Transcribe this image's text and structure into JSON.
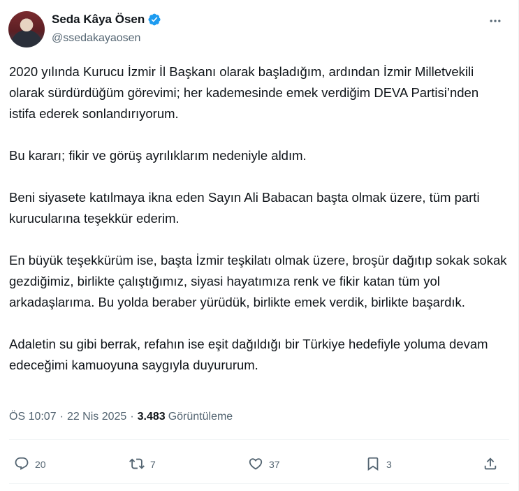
{
  "author": {
    "name": "Seda Kâya Ösen",
    "handle": "@ssedakayaosen"
  },
  "tweet": {
    "text": "2020 yılında Kurucu İzmir İl Başkanı olarak başladığım, ardından İzmir Milletvekili olarak sürdürdüğüm görevimi; her kademesinde emek verdiğim DEVA Partisi’nden istifa ederek sonlandırıyorum.\n\nBu kararı; fikir ve görüş ayrılıklarım nedeniyle aldım.\n\nBeni siyasete katılmaya ikna eden Sayın Ali Babacan başta olmak üzere, tüm parti kurucularına teşekkür ederim.\n\nEn büyük teşekkürüm ise, başta İzmir teşkilatı olmak üzere, broşür dağıtıp sokak sokak gezdiğimiz, birlikte çalıştığımız, siyasi hayatımıza renk ve fikir katan tüm yol arkadaşlarıma. Bu yolda beraber yürüdük, birlikte emek verdik, birlikte başardık.\n\nAdaletin su gibi berrak, refahın ise eşit dağıldığı bir Türkiye hedefiyle yoluma devam edeceğimi kamuoyuna saygıyla duyururum.",
    "time": "ÖS 10:07",
    "date": "22 Nis 2025",
    "views_count": "3.483",
    "views_label": "Görüntüleme"
  },
  "actions": {
    "replies": "20",
    "retweets": "7",
    "likes": "37",
    "bookmarks": "3"
  },
  "icons": {
    "verified": "verified-badge-icon",
    "more": "more-dots-icon",
    "reply": "reply-icon",
    "retweet": "retweet-icon",
    "like": "heart-icon",
    "bookmark": "bookmark-icon",
    "share": "share-icon"
  },
  "colors": {
    "verified": "#1d9bf0",
    "muted": "#536471",
    "text": "#0f1419"
  }
}
